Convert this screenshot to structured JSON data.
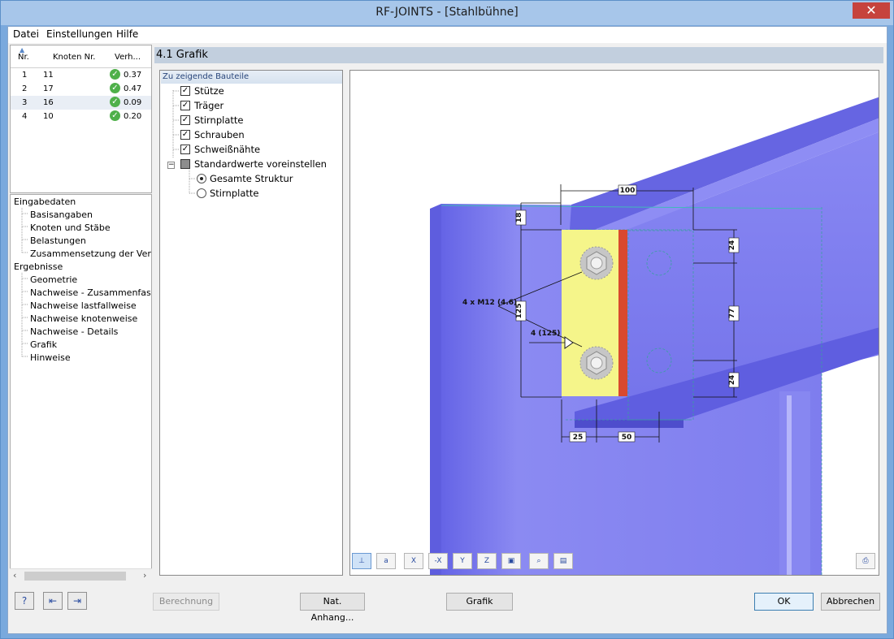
{
  "window": {
    "title": "RF-JOINTS - [Stahlbühne]",
    "close": "✕"
  },
  "menu": [
    "Datei",
    "Einstellungen",
    "Hilfe"
  ],
  "node_table": {
    "headers": [
      "Nr.",
      "Knoten Nr.",
      "Verh..."
    ],
    "rows": [
      {
        "nr": "1",
        "knoten": "11",
        "ratio": "0.37"
      },
      {
        "nr": "2",
        "knoten": "17",
        "ratio": "0.47"
      },
      {
        "nr": "3",
        "knoten": "16",
        "ratio": "0.09"
      },
      {
        "nr": "4",
        "knoten": "10",
        "ratio": "0.20"
      }
    ],
    "status_icon": "check-circle-icon",
    "status_color": "#4fb04a"
  },
  "nav_tree": {
    "group1": "Eingabedaten",
    "group1_items": [
      "Basisangaben",
      "Knoten und Stäbe",
      "Belastungen",
      "Zusammensetzung der Verbindung"
    ],
    "group2": "Ergebnisse",
    "group2_items": [
      "Geometrie",
      "Nachweise - Zusammenfassung",
      "Nachweise lastfallweise",
      "Nachweise knotenweise",
      "Nachweise - Details",
      "Grafik",
      "Hinweise"
    ]
  },
  "section": {
    "title": "4.1 Grafik"
  },
  "parts": {
    "tab_label": "Zu zeigende Bauteile",
    "items": [
      {
        "label": "Stütze",
        "checked": true
      },
      {
        "label": "Träger",
        "checked": true
      },
      {
        "label": "Stirnplatte",
        "checked": true
      },
      {
        "label": "Schrauben",
        "checked": true
      },
      {
        "label": "Schweißnähte",
        "checked": true
      }
    ],
    "defaults_label": "Standardwerte voreinstellen",
    "radio_options": [
      {
        "label": "Gesamte Struktur",
        "selected": true
      },
      {
        "label": "Stirnplatte",
        "selected": false
      }
    ]
  },
  "drawing": {
    "dims": {
      "top_width": "100",
      "top_offset": "18",
      "edge_top": "24",
      "height": "125",
      "bolt_spacing": "77",
      "edge_bottom": "24",
      "plate_edge": "25",
      "bolt_gauge": "50"
    },
    "bolt_label": "4 x M12 (4.6)",
    "weld_label": "4 (125)",
    "colors": {
      "steel": "#7877ef",
      "steel_dark": "#5a58d6",
      "plate": "#f5f58a",
      "weld": "#d9492e",
      "beam_flange": "#6261e0"
    }
  },
  "graph_toolbar": [
    "tb-1",
    "tb-2",
    "x-axis-icon",
    "x-axis-neg-icon",
    "y-axis-icon",
    "z-axis-icon",
    "iso-view-icon",
    "zoom-icon",
    "layers-icon",
    "print-icon"
  ],
  "buttons": {
    "calculation": "Berechnung",
    "national_annex": "Nat. Anhang...",
    "graphic": "Grafik",
    "ok": "OK",
    "cancel": "Abbrechen"
  }
}
